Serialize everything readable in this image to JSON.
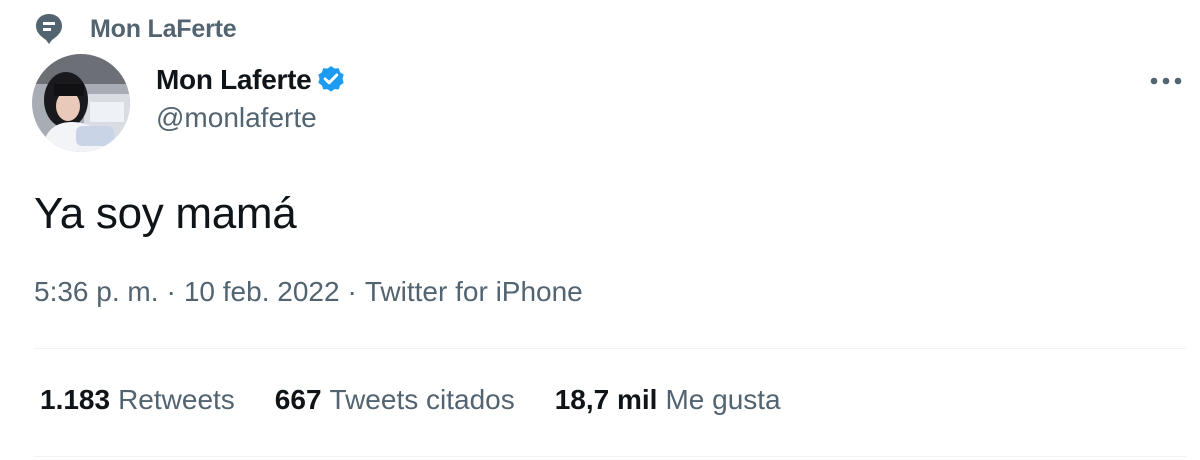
{
  "pinned_label": "Mon LaFerte",
  "author": {
    "display_name": "Mon Laferte",
    "handle": "@monlaferte",
    "verified": true
  },
  "tweet": {
    "text": "Ya soy mamá",
    "time": "5:36 p. m.",
    "date": "10 feb. 2022",
    "source": "Twitter for iPhone",
    "separator": "·"
  },
  "stats": [
    {
      "count": "1.183",
      "label": "Retweets"
    },
    {
      "count": "667",
      "label": "Tweets citados"
    },
    {
      "count": "18,7 mil",
      "label": "Me gusta"
    }
  ],
  "colors": {
    "text_primary": "#0f1419",
    "text_secondary": "#536471",
    "verified": "#1d9bf0",
    "divider": "#eff3f4"
  },
  "icons": {
    "pin": "location-pin-icon",
    "verified": "verified-badge-icon",
    "more": "more-options-icon"
  }
}
